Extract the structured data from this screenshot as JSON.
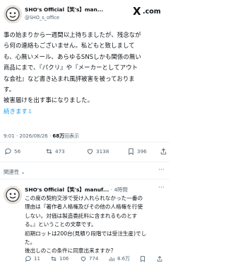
{
  "post": {
    "account_name": "SHO's Official【笑's】man...",
    "account_handle": "@SHO_s_office",
    "brand_x": "X",
    "brand_com": ".com",
    "body_lines": [
      "事の始まりから一週間以上待ちましたが、残念なが",
      "ら何の連絡もございません。私どもと致しまして",
      "も、心無いメール、あらゆるSNSしかも関係の無い",
      "商品にまで、『パクリ』や『メーカーとしてアウト",
      "な会社』など書き込まれ風評被害を被っておりま",
      "す。",
      "被害届けを出す事になりました。"
    ],
    "more_text": "続きます⇩",
    "timestamp": "9:01 · 2026/08/26 · ",
    "views_count": "68万",
    "views_label": "回表示",
    "actions": {
      "replies": "56",
      "reposts": "473",
      "likes": "3138",
      "bookmarks": "396"
    }
  },
  "related_label": "関連性 ⌄",
  "more_icon": "···",
  "reply": {
    "account_name": "SHO's Official【笑's】manuf...",
    "time": " · 4時間",
    "body_lines": [
      "この度の契約交渉で受け入れられなかった一番の",
      "理由は『著作者人格権及びその他の人格権を行使",
      "しない。対価は製造委託料に含まれるものとす",
      "る。』ということの文章です。",
      "初期ロットは200台(見積り段階では受注生産)でし",
      "た。",
      "後出しのこの条件に同意出来ますか？"
    ],
    "actions": {
      "replies": "11",
      "reposts": "106",
      "likes": "774",
      "views": "8.6万"
    }
  }
}
